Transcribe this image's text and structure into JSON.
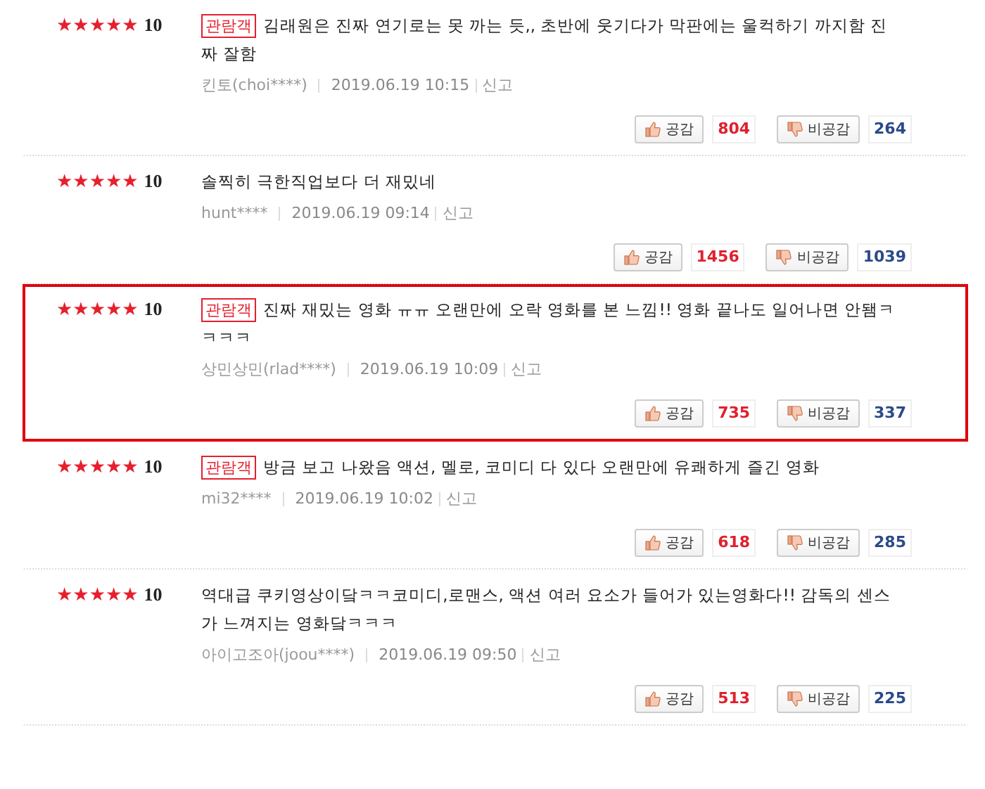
{
  "reviews": [
    {
      "stars": 5,
      "score": "10",
      "badge": "관람객",
      "text": "김래원은 진짜 연기로는 못 까는 듯,, 초반에 웃기다가 막판에는 울컥하기 까지함 진짜 잘함",
      "author": "킨토(choi****)",
      "date": "2019.06.19 10:15",
      "report": "신고",
      "like_label": "공감",
      "likes": "804",
      "dislike_label": "비공감",
      "dislikes": "264",
      "highlighted": false
    },
    {
      "stars": 5,
      "score": "10",
      "text": "솔찍히 극한직업보다 더 재밌네",
      "author": "hunt****",
      "date": "2019.06.19 09:14",
      "report": "신고",
      "like_label": "공감",
      "likes": "1456",
      "dislike_label": "비공감",
      "dislikes": "1039",
      "highlighted": false
    },
    {
      "stars": 5,
      "score": "10",
      "badge": "관람객",
      "text": "진짜 재밌는 영화 ㅠㅠ 오랜만에 오락 영화를 본 느낌!! 영화 끝나도 일어나면 안됌ㅋㅋㅋㅋ",
      "author": "상민상민(rlad****)",
      "date": "2019.06.19 10:09",
      "report": "신고",
      "like_label": "공감",
      "likes": "735",
      "dislike_label": "비공감",
      "dislikes": "337",
      "highlighted": true
    },
    {
      "stars": 5,
      "score": "10",
      "badge": "관람객",
      "text": "방금 보고 나왔음 액션, 멜로, 코미디 다 있다 오랜만에 유쾌하게 즐긴 영화",
      "author": "mi32****",
      "date": "2019.06.19 10:02",
      "report": "신고",
      "like_label": "공감",
      "likes": "618",
      "dislike_label": "비공감",
      "dislikes": "285",
      "highlighted": false
    },
    {
      "stars": 5,
      "score": "10",
      "text": "역대급 쿠키영상이닼ㅋㅋ코미디,로맨스, 액션 여러 요소가 들어가 있는영화다!! 감독의 센스가 느껴지는 영화닼ㅋㅋㅋ",
      "author": "아이고조아(joou****)",
      "date": "2019.06.19 09:50",
      "report": "신고",
      "like_label": "공감",
      "likes": "513",
      "dislike_label": "비공감",
      "dislikes": "225",
      "highlighted": false
    }
  ]
}
